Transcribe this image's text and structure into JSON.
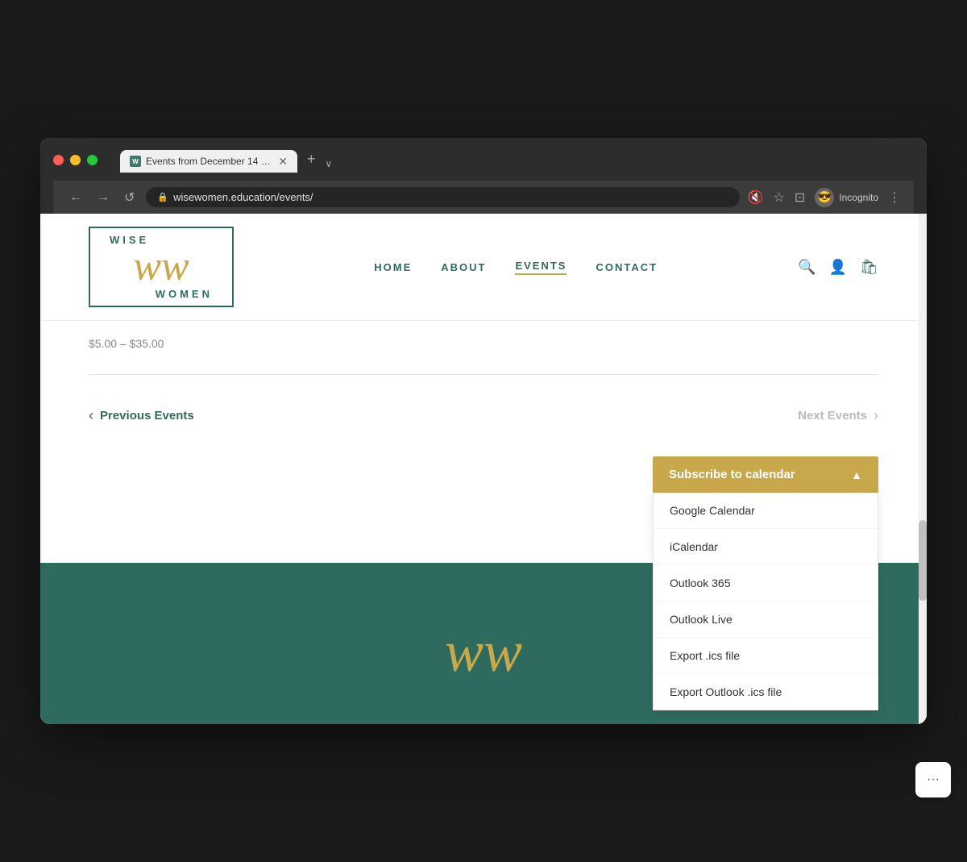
{
  "browser": {
    "tab_title": "Events from December 14 – Se",
    "tab_favicon_text": "W",
    "url": "wisewomen.education/events/",
    "incognito_label": "Incognito"
  },
  "header": {
    "logo": {
      "wise_text": "WISE",
      "ww_text": "ww",
      "women_text": "WOMEN"
    },
    "nav": {
      "items": [
        {
          "label": "HOME",
          "active": false
        },
        {
          "label": "ABOUT",
          "active": false
        },
        {
          "label": "EVENTS",
          "active": true
        },
        {
          "label": "CONTACT",
          "active": false
        }
      ]
    }
  },
  "main": {
    "price_range": "$5.00 – $35.00",
    "pagination": {
      "prev_label": "Previous Events",
      "next_label": "Next Events"
    },
    "subscribe": {
      "button_label": "Subscribe to calendar",
      "dropdown_items": [
        "Google Calendar",
        "iCalendar",
        "Outlook 365",
        "Outlook Live",
        "Export .ics file",
        "Export Outlook .ics file"
      ]
    }
  },
  "footer": {
    "logo_text": "ww"
  },
  "chat": {
    "icon": "···"
  }
}
